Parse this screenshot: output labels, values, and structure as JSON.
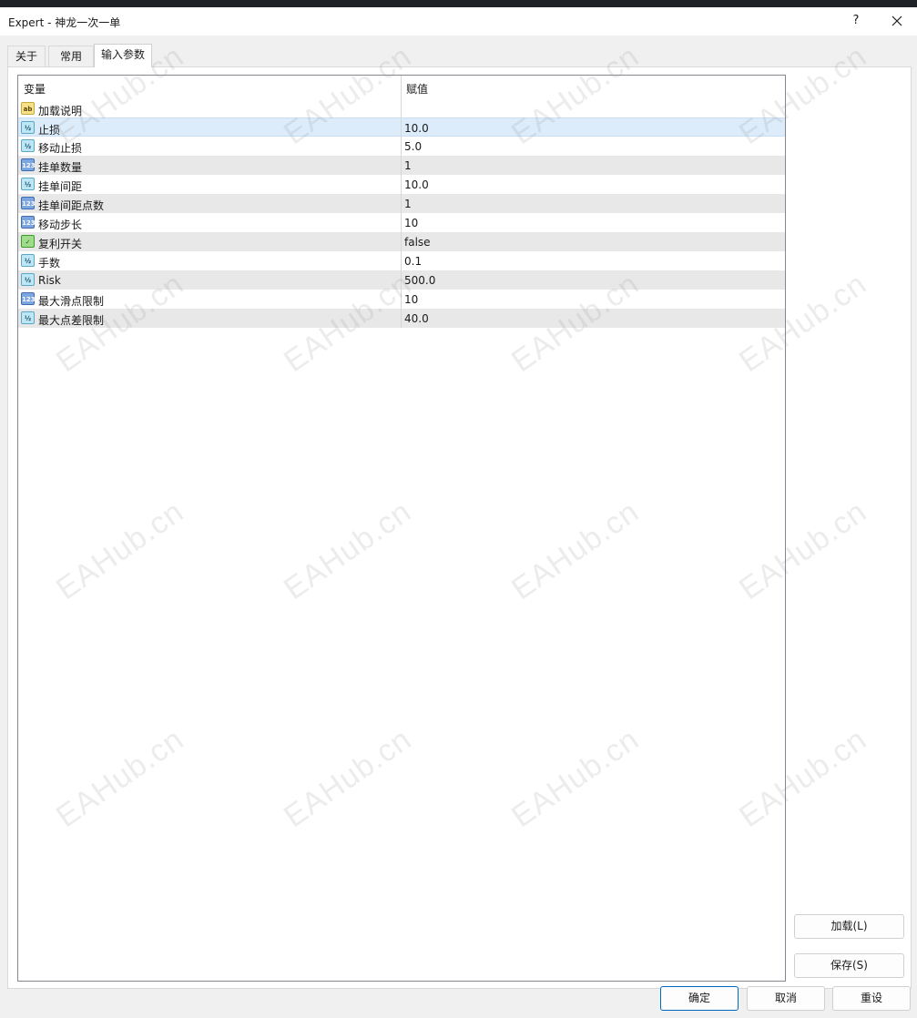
{
  "window": {
    "title": "Expert - 神龙一次一单",
    "help_label": "?"
  },
  "tabs": [
    {
      "label": "关于"
    },
    {
      "label": "常用"
    },
    {
      "label": "输入参数"
    }
  ],
  "grid": {
    "columns": [
      "变量",
      "赋值"
    ],
    "rows": [
      {
        "icon": "string-type-icon",
        "icon_text": "ab",
        "name": "加载说明",
        "value": ""
      },
      {
        "icon": "double-type-icon",
        "icon_text": "½",
        "name": "止损",
        "value": "10.0"
      },
      {
        "icon": "double-type-icon",
        "icon_text": "½",
        "name": "移动止损",
        "value": "5.0"
      },
      {
        "icon": "integer-type-icon",
        "icon_text": "123",
        "name": "挂单数量",
        "value": "1"
      },
      {
        "icon": "double-type-icon",
        "icon_text": "½",
        "name": "挂单间距",
        "value": "10.0"
      },
      {
        "icon": "integer-type-icon",
        "icon_text": "123",
        "name": "挂单间距点数",
        "value": "1"
      },
      {
        "icon": "integer-type-icon",
        "icon_text": "123",
        "name": "移动步长",
        "value": "10"
      },
      {
        "icon": "boolean-type-icon",
        "icon_text": "✓",
        "name": "复利开关",
        "value": "false"
      },
      {
        "icon": "double-type-icon",
        "icon_text": "½",
        "name": "手数",
        "value": "0.1"
      },
      {
        "icon": "double-type-icon",
        "icon_text": "½",
        "name": "Risk",
        "value": "500.0"
      },
      {
        "icon": "integer-type-icon",
        "icon_text": "123",
        "name": "最大滑点限制",
        "value": "10"
      },
      {
        "icon": "double-type-icon",
        "icon_text": "½",
        "name": "最大点差限制",
        "value": "40.0"
      }
    ]
  },
  "buttons": {
    "load": "加载(L)",
    "save": "保存(S)",
    "ok": "确定",
    "cancel": "取消",
    "reset": "重设"
  },
  "watermark": "EAHub.cn"
}
